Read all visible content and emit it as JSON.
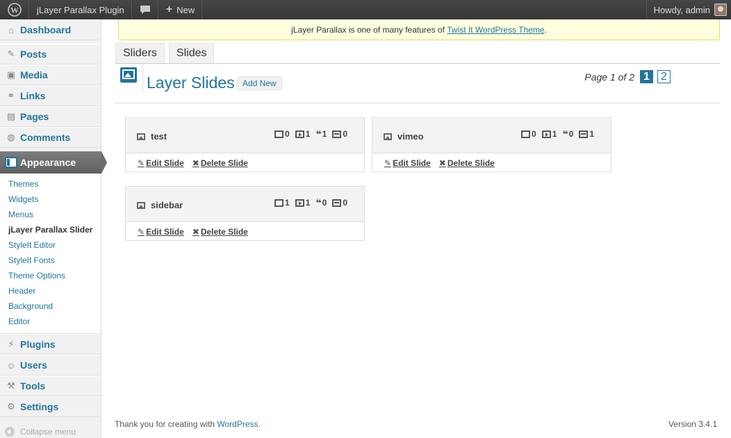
{
  "adminbar": {
    "site_name": "jLayer Parallax Plugin",
    "new_label": "New",
    "howdy": "Howdy, admin"
  },
  "sidebar": {
    "top_items": [
      {
        "label": "Dashboard",
        "icon": "dashboard-icon"
      },
      {
        "label": "Posts",
        "icon": "pin-icon"
      },
      {
        "label": "Media",
        "icon": "media-icon"
      },
      {
        "label": "Links",
        "icon": "link-icon"
      },
      {
        "label": "Pages",
        "icon": "pages-icon"
      },
      {
        "label": "Comments",
        "icon": "comments-icon"
      }
    ],
    "active": {
      "label": "Appearance",
      "icon": "appearance-icon"
    },
    "submenu": [
      "Themes",
      "Widgets",
      "Menus",
      "jLayer Parallax Slider",
      "StyleIt Editor",
      "StyleIt Fonts",
      "Theme Options",
      "Header",
      "Background",
      "Editor"
    ],
    "bottom_items": [
      {
        "label": "Plugins",
        "icon": "plugin-icon"
      },
      {
        "label": "Users",
        "icon": "users-icon"
      },
      {
        "label": "Tools",
        "icon": "tools-icon"
      },
      {
        "label": "Settings",
        "icon": "settings-icon"
      }
    ],
    "collapse": "Collapse menu"
  },
  "notice": {
    "prefix": "jLayer Parallax is one of many features of ",
    "link": "Twist It WordPress Theme",
    "suffix": "."
  },
  "tabs": [
    "Sliders",
    "Slides"
  ],
  "page": {
    "title": "Layer Slides",
    "add_new": "Add New",
    "pager_text": "Page 1 of 2",
    "pages": [
      "1",
      "2"
    ]
  },
  "slides": [
    {
      "name": "test",
      "images": "0",
      "videos": "1",
      "captions": "1",
      "boxes": "0"
    },
    {
      "name": "vimeo",
      "images": "0",
      "videos": "1",
      "captions": "0",
      "boxes": "1"
    },
    {
      "name": "sidebar",
      "images": "1",
      "videos": "1",
      "captions": "0",
      "boxes": "0"
    }
  ],
  "actions": {
    "edit": "Edit Slide",
    "delete": "Delete Slide"
  },
  "footer": {
    "thanks": "Thank you for creating with ",
    "wp": "WordPress",
    "dot": ".",
    "version": "Version 3.4.1"
  },
  "colors": {
    "accent": "#21759b",
    "notice_bg": "#ffffe0",
    "adminbar": "#464646"
  }
}
